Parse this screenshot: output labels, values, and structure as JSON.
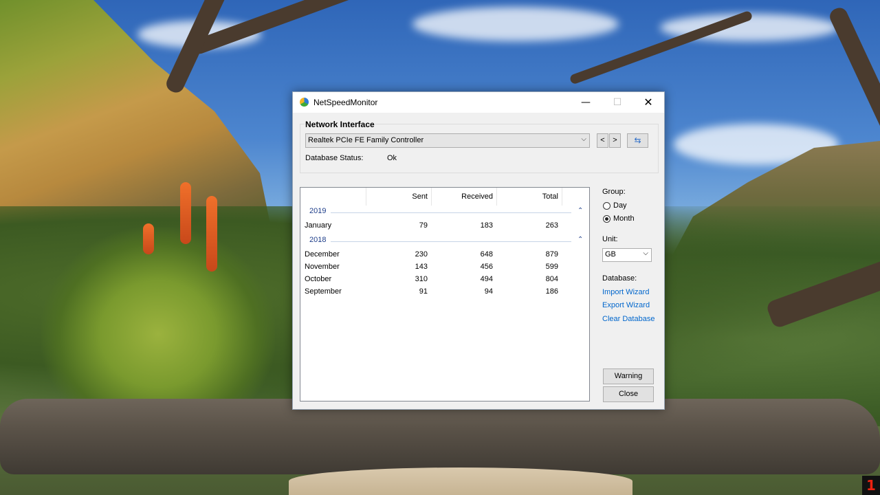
{
  "window": {
    "title": "NetSpeedMonitor",
    "controls": {
      "minimize": "—",
      "maximize": "☐",
      "close": "✕"
    }
  },
  "network_interface": {
    "label": "Network Interface",
    "selected": "Realtek PCIe FE Family Controller",
    "prev_label": "<",
    "next_label": ">",
    "refresh_icon": "refresh-icon",
    "database_status_label": "Database Status:",
    "database_status_value": "Ok"
  },
  "table": {
    "columns": [
      "",
      "Sent",
      "Received",
      "Total"
    ],
    "groups": [
      {
        "year": "2019",
        "rows": [
          {
            "month": "January",
            "sent": "79",
            "received": "183",
            "total": "263"
          }
        ]
      },
      {
        "year": "2018",
        "rows": [
          {
            "month": "December",
            "sent": "230",
            "received": "648",
            "total": "879"
          },
          {
            "month": "November",
            "sent": "143",
            "received": "456",
            "total": "599"
          },
          {
            "month": "October",
            "sent": "310",
            "received": "494",
            "total": "804"
          },
          {
            "month": "September",
            "sent": "91",
            "received": "94",
            "total": "186"
          }
        ]
      }
    ]
  },
  "side_panel": {
    "group_label": "Group:",
    "group_options": [
      {
        "label": "Day",
        "checked": false
      },
      {
        "label": "Month",
        "checked": true
      }
    ],
    "unit_label": "Unit:",
    "unit_value": "GB",
    "database_label": "Database:",
    "links": [
      "Import Wizard",
      "Export Wizard",
      "Clear Database"
    ],
    "warning_button": "Warning",
    "close_button": "Close"
  },
  "taskbar": {
    "badge": "1"
  },
  "colors": {
    "link": "#0066cc",
    "group_header": "#1e3e8a",
    "accent": "#2e6fc9"
  }
}
